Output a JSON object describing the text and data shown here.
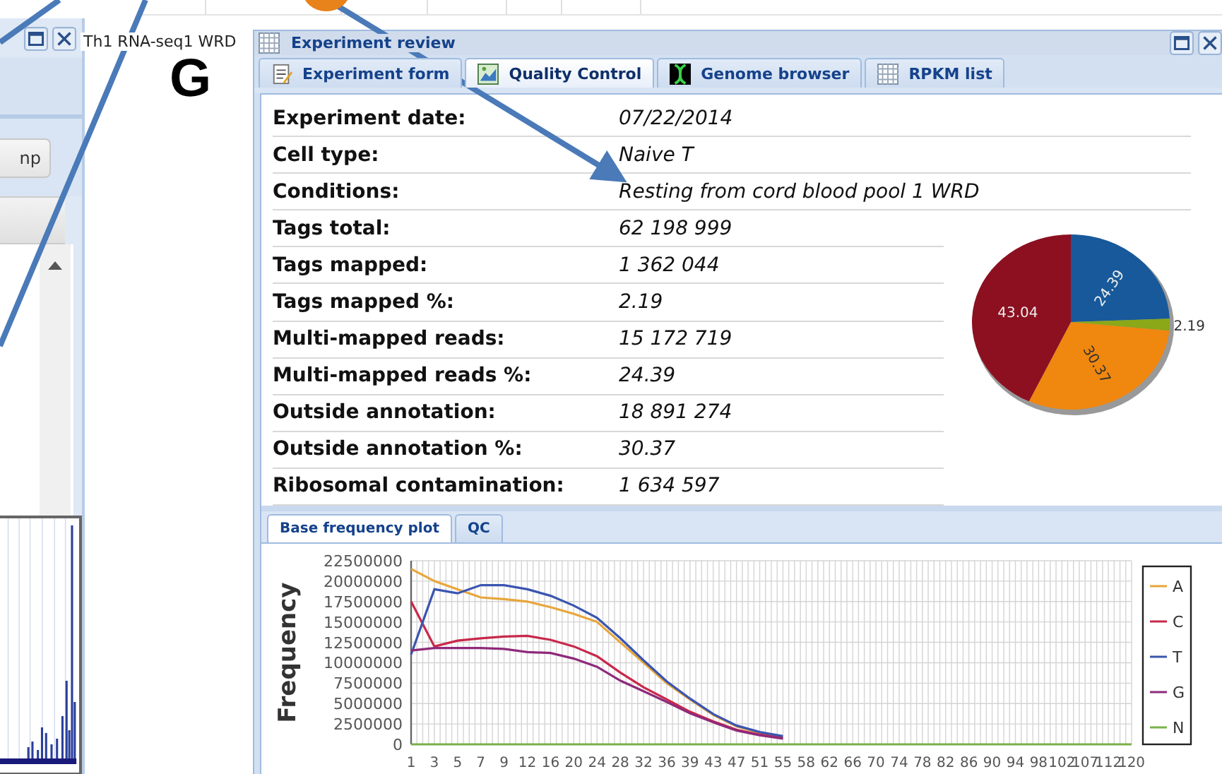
{
  "left_window": {
    "button": "np"
  },
  "panel_label": "G",
  "sample_label": "Th1 RNA-seq1 WRD",
  "window": {
    "title": "Experiment review"
  },
  "tabs": [
    {
      "label": "Experiment form",
      "selected": false,
      "kind": "form"
    },
    {
      "label": "Quality Control",
      "selected": true,
      "kind": "chart"
    },
    {
      "label": "Genome browser",
      "selected": false,
      "kind": "genome"
    },
    {
      "label": "RPKM list",
      "selected": false,
      "kind": "grid"
    }
  ],
  "fields": [
    {
      "label": "Experiment date:",
      "value": "07/22/2014"
    },
    {
      "label": "Cell type:",
      "value": "Naive T"
    },
    {
      "label": "Conditions:",
      "value": "Resting from cord blood pool 1 WRD"
    },
    {
      "label": "Tags total:",
      "value": "62 198 999"
    },
    {
      "label": "Tags mapped:",
      "value": "1 362 044"
    },
    {
      "label": "Tags mapped %:",
      "value": "2.19"
    },
    {
      "label": "Multi-mapped reads:",
      "value": "15 172 719"
    },
    {
      "label": "Multi-mapped reads %:",
      "value": "24.39"
    },
    {
      "label": "Outside annotation:",
      "value": "18 891 274"
    },
    {
      "label": "Outside annotation %:",
      "value": "30.37"
    },
    {
      "label": "Ribosomal contamination:",
      "value": "1 634 597"
    }
  ],
  "pie": {
    "chart_data": {
      "type": "pie",
      "data_labels": true,
      "values": [
        24.39,
        2.19,
        30.37,
        43.04
      ],
      "colors": [
        "#17599a",
        "#8aa818",
        "#f0870e",
        "#8c1020"
      ]
    }
  },
  "subtabs": [
    {
      "label": "Base frequency plot",
      "selected": true
    },
    {
      "label": "QC",
      "selected": false
    }
  ],
  "plot": {
    "chart_data": {
      "type": "line",
      "ylabel": "Frequency",
      "categories": [
        "1",
        "3",
        "5",
        "7",
        "9",
        "12",
        "16",
        "20",
        "24",
        "28",
        "32",
        "36",
        "39",
        "43",
        "47",
        "51",
        "55",
        "58",
        "62",
        "66",
        "70",
        "74",
        "78",
        "82",
        "86",
        "90",
        "94",
        "98",
        "102",
        "107",
        "112",
        "120"
      ],
      "ylim": [
        0,
        22500000
      ],
      "grid": true,
      "legend": "right",
      "yticks": [
        0,
        2500000,
        5000000,
        7500000,
        10000000,
        12500000,
        15000000,
        17500000,
        20000000,
        22500000
      ],
      "series": [
        {
          "name": "A",
          "color": "#e8a63a",
          "values": [
            21500000,
            20000000,
            19000000,
            18000000,
            17800000,
            17500000,
            16800000,
            16000000,
            15000000,
            12500000,
            10000000,
            7500000,
            5500000,
            3600000,
            2200000,
            1400000,
            900000,
            null,
            null,
            null,
            null,
            null,
            null,
            null,
            null,
            null,
            null,
            null,
            null,
            null,
            null,
            null
          ]
        },
        {
          "name": "C",
          "color": "#c8284a",
          "values": [
            17500000,
            12000000,
            12700000,
            13000000,
            13200000,
            13300000,
            12800000,
            12000000,
            10800000,
            8800000,
            7000000,
            5500000,
            4000000,
            2800000,
            1800000,
            1200000,
            800000,
            null,
            null,
            null,
            null,
            null,
            null,
            null,
            null,
            null,
            null,
            null,
            null,
            null,
            null,
            null
          ]
        },
        {
          "name": "T",
          "color": "#3a55b0",
          "values": [
            11000000,
            19000000,
            18500000,
            19500000,
            19500000,
            19000000,
            18200000,
            17000000,
            15500000,
            13000000,
            10300000,
            7700000,
            5600000,
            3700000,
            2300000,
            1500000,
            1000000,
            null,
            null,
            null,
            null,
            null,
            null,
            null,
            null,
            null,
            null,
            null,
            null,
            null,
            null,
            null
          ]
        },
        {
          "name": "G",
          "color": "#8e2a7a",
          "values": [
            11500000,
            11800000,
            11800000,
            11800000,
            11700000,
            11300000,
            11200000,
            10500000,
            9500000,
            7800000,
            6500000,
            5200000,
            3800000,
            2700000,
            1700000,
            1100000,
            700000,
            null,
            null,
            null,
            null,
            null,
            null,
            null,
            null,
            null,
            null,
            null,
            null,
            null,
            null,
            null
          ]
        },
        {
          "name": "N",
          "color": "#7ab04a",
          "values": [
            0,
            0,
            0,
            0,
            0,
            0,
            0,
            0,
            0,
            0,
            0,
            0,
            0,
            0,
            0,
            0,
            0,
            0,
            0,
            0,
            0,
            0,
            0,
            0,
            0,
            0,
            0,
            0,
            0,
            0,
            0,
            0
          ]
        }
      ]
    }
  }
}
